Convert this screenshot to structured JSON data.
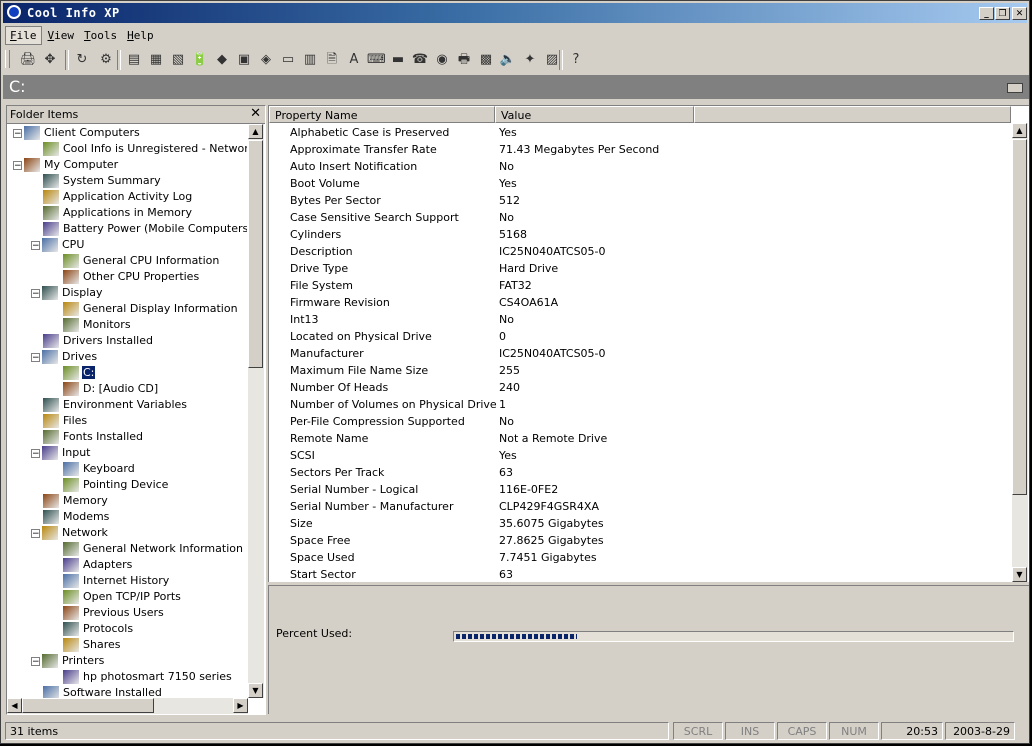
{
  "window": {
    "title": "Cool Info XP"
  },
  "menu": [
    {
      "label": "File",
      "active": true
    },
    {
      "label": "View",
      "active": false
    },
    {
      "label": "Tools",
      "active": false
    },
    {
      "label": "Help",
      "active": false
    }
  ],
  "toolbar_icons": [
    "printer-icon",
    "move-icon",
    "refresh-icon",
    "wizard-icon",
    "system-summary-icon",
    "application-log-icon",
    "applications-memory-icon",
    "battery-icon",
    "cpu-icon",
    "display-icon",
    "drivers-icon",
    "drives-icon",
    "environment-icon",
    "files-icon",
    "fonts-icon",
    "input-icon",
    "memory-icon",
    "modems-icon",
    "network-icon",
    "printers-icon",
    "software-icon",
    "sound-icon",
    "startup-icon",
    "tasks-icon",
    "help-icon"
  ],
  "path": {
    "current": "C:"
  },
  "folder_pane": {
    "title": "Folder Items"
  },
  "tree": [
    {
      "label": "Client Computers",
      "level": 0,
      "expander": "−",
      "icon": "client-computers-icon"
    },
    {
      "label": "Cool Info is Unregistered - Network W",
      "level": 1,
      "expander": "",
      "icon": "network-warning-icon"
    },
    {
      "label": "My Computer",
      "level": 0,
      "expander": "−",
      "icon": "my-computer-icon"
    },
    {
      "label": "System Summary",
      "level": 1,
      "expander": "",
      "icon": "system-summary-icon"
    },
    {
      "label": "Application Activity Log",
      "level": 1,
      "expander": "",
      "icon": "application-log-icon"
    },
    {
      "label": "Applications in Memory",
      "level": 1,
      "expander": "",
      "icon": "applications-memory-icon"
    },
    {
      "label": "Battery Power (Mobile Computers)",
      "level": 1,
      "expander": "",
      "icon": "battery-icon"
    },
    {
      "label": "CPU",
      "level": 1,
      "expander": "−",
      "icon": "cpu-icon"
    },
    {
      "label": "General CPU Information",
      "level": 2,
      "expander": "",
      "icon": "cpu-info-icon"
    },
    {
      "label": "Other CPU Properties",
      "level": 2,
      "expander": "",
      "icon": "cpu-properties-icon"
    },
    {
      "label": "Display",
      "level": 1,
      "expander": "−",
      "icon": "display-icon"
    },
    {
      "label": "General Display Information",
      "level": 2,
      "expander": "",
      "icon": "display-info-icon"
    },
    {
      "label": "Monitors",
      "level": 2,
      "expander": "",
      "icon": "monitor-icon"
    },
    {
      "label": "Drivers Installed",
      "level": 1,
      "expander": "",
      "icon": "drivers-icon"
    },
    {
      "label": "Drives",
      "level": 1,
      "expander": "−",
      "icon": "drives-icon"
    },
    {
      "label": "C:",
      "level": 2,
      "expander": "",
      "icon": "hard-drive-icon",
      "selected": true
    },
    {
      "label": "D: [Audio CD]",
      "level": 2,
      "expander": "",
      "icon": "cd-drive-icon"
    },
    {
      "label": "Environment Variables",
      "level": 1,
      "expander": "",
      "icon": "environment-icon"
    },
    {
      "label": "Files",
      "level": 1,
      "expander": "",
      "icon": "files-icon"
    },
    {
      "label": "Fonts Installed",
      "level": 1,
      "expander": "",
      "icon": "fonts-icon"
    },
    {
      "label": "Input",
      "level": 1,
      "expander": "−",
      "icon": "input-icon"
    },
    {
      "label": "Keyboard",
      "level": 2,
      "expander": "",
      "icon": "keyboard-icon"
    },
    {
      "label": "Pointing Device",
      "level": 2,
      "expander": "",
      "icon": "mouse-icon"
    },
    {
      "label": "Memory",
      "level": 1,
      "expander": "",
      "icon": "memory-icon"
    },
    {
      "label": "Modems",
      "level": 1,
      "expander": "",
      "icon": "modems-icon"
    },
    {
      "label": "Network",
      "level": 1,
      "expander": "−",
      "icon": "network-icon"
    },
    {
      "label": "General Network Information",
      "level": 2,
      "expander": "",
      "icon": "network-info-icon"
    },
    {
      "label": "Adapters",
      "level": 2,
      "expander": "",
      "icon": "adapters-icon"
    },
    {
      "label": "Internet History",
      "level": 2,
      "expander": "",
      "icon": "internet-history-icon"
    },
    {
      "label": "Open TCP/IP Ports",
      "level": 2,
      "expander": "",
      "icon": "ports-icon"
    },
    {
      "label": "Previous Users",
      "level": 2,
      "expander": "",
      "icon": "users-icon"
    },
    {
      "label": "Protocols",
      "level": 2,
      "expander": "",
      "icon": "protocols-icon"
    },
    {
      "label": "Shares",
      "level": 2,
      "expander": "",
      "icon": "shares-icon"
    },
    {
      "label": "Printers",
      "level": 1,
      "expander": "−",
      "icon": "printers-icon"
    },
    {
      "label": "hp photosmart 7150 series",
      "level": 2,
      "expander": "",
      "icon": "printer-icon"
    },
    {
      "label": "Software Installed",
      "level": 1,
      "expander": "",
      "icon": "software-icon"
    }
  ],
  "columns": {
    "name": "Property Name",
    "value": "Value"
  },
  "properties": [
    {
      "name": "Alphabetic Case is Preserved",
      "value": "Yes"
    },
    {
      "name": "Approximate Transfer Rate",
      "value": "71.43 Megabytes Per Second"
    },
    {
      "name": "Auto Insert Notification",
      "value": "No"
    },
    {
      "name": "Boot Volume",
      "value": "Yes"
    },
    {
      "name": "Bytes Per Sector",
      "value": "512"
    },
    {
      "name": "Case Sensitive Search Support",
      "value": "No"
    },
    {
      "name": "Cylinders",
      "value": "5168"
    },
    {
      "name": "Description",
      "value": "IC25N040ATCS05-0"
    },
    {
      "name": "Drive Type",
      "value": "Hard Drive"
    },
    {
      "name": "File System",
      "value": "FAT32"
    },
    {
      "name": "Firmware Revision",
      "value": "CS4OA61A"
    },
    {
      "name": "Int13",
      "value": "No"
    },
    {
      "name": "Located on Physical Drive",
      "value": "0"
    },
    {
      "name": "Manufacturer",
      "value": "IC25N040ATCS05-0"
    },
    {
      "name": "Maximum File Name Size",
      "value": "255"
    },
    {
      "name": "Number Of Heads",
      "value": "240"
    },
    {
      "name": "Number of Volumes on Physical Drive",
      "value": "1"
    },
    {
      "name": "Per-File Compression Supported",
      "value": "No"
    },
    {
      "name": "Remote Name",
      "value": "Not a Remote Drive"
    },
    {
      "name": "SCSI",
      "value": "Yes"
    },
    {
      "name": "Sectors Per Track",
      "value": "63"
    },
    {
      "name": "Serial Number - Logical",
      "value": "116E-0FE2"
    },
    {
      "name": "Serial Number - Manufacturer",
      "value": "CLP429F4GSR4XA"
    },
    {
      "name": "Size",
      "value": "35.6075 Gigabytes"
    },
    {
      "name": "Space Free",
      "value": "27.8625 Gigabytes"
    },
    {
      "name": "Space Used",
      "value": "7.7451 Gigabytes"
    },
    {
      "name": "Start Sector",
      "value": "63"
    }
  ],
  "detail": {
    "percent_label": "Percent Used:",
    "percent_used": 0.2175
  },
  "status": {
    "items": "31 items",
    "scrl": "SCRL",
    "ins": "INS",
    "caps": "CAPS",
    "num": "NUM",
    "time": "20:53",
    "date": "2003-8-29"
  },
  "colors": {
    "title_start": "#0a246a",
    "title_end": "#a6caf0",
    "selection": "#0a246a",
    "face": "#d4d0c8"
  }
}
